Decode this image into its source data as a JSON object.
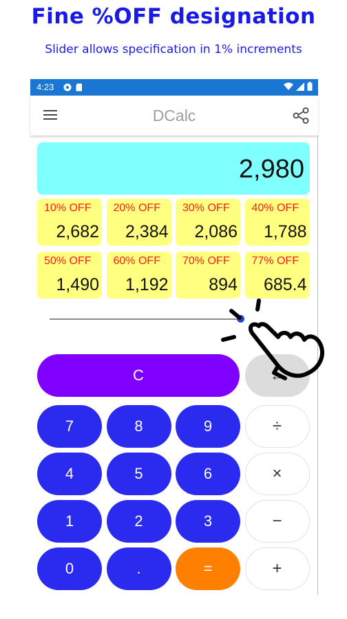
{
  "promo": {
    "headline": "Fine %OFF designation",
    "subline": "Slider allows specification in 1% increments"
  },
  "status_bar": {
    "time": "4:23"
  },
  "app_bar": {
    "title": "DCalc"
  },
  "display": {
    "value": "2,980"
  },
  "discounts": [
    {
      "label": "10% OFF",
      "value": "2,682"
    },
    {
      "label": "20% OFF",
      "value": "2,384"
    },
    {
      "label": "30% OFF",
      "value": "2,086"
    },
    {
      "label": "40% OFF",
      "value": "1,788"
    },
    {
      "label": "50% OFF",
      "value": "1,490"
    },
    {
      "label": "60% OFF",
      "value": "1,192"
    },
    {
      "label": "70% OFF",
      "value": "894"
    },
    {
      "label": "77% OFF",
      "value": "685.4"
    }
  ],
  "slider": {
    "percent": 77
  },
  "keypad": {
    "clear": "C",
    "backspace": "←",
    "rows": [
      [
        "7",
        "8",
        "9",
        "÷"
      ],
      [
        "4",
        "5",
        "6",
        "×"
      ],
      [
        "1",
        "2",
        "3",
        "−"
      ],
      [
        "0",
        ".",
        "=",
        "+"
      ]
    ]
  },
  "colors": {
    "headline": "#1a1ae6",
    "status_bar": "#1976d2",
    "display_bg": "#80ffff",
    "discount_bg": "#ffff80",
    "discount_label": "#ff1a1a",
    "number_key": "#2b2bf0",
    "clear_key": "#8000ff",
    "equals_key": "#ff8000"
  },
  "icons": {
    "menu": "hamburger-icon",
    "share": "share-icon",
    "wifi": "wifi-icon",
    "signal": "signal-icon",
    "battery": "battery-icon"
  }
}
